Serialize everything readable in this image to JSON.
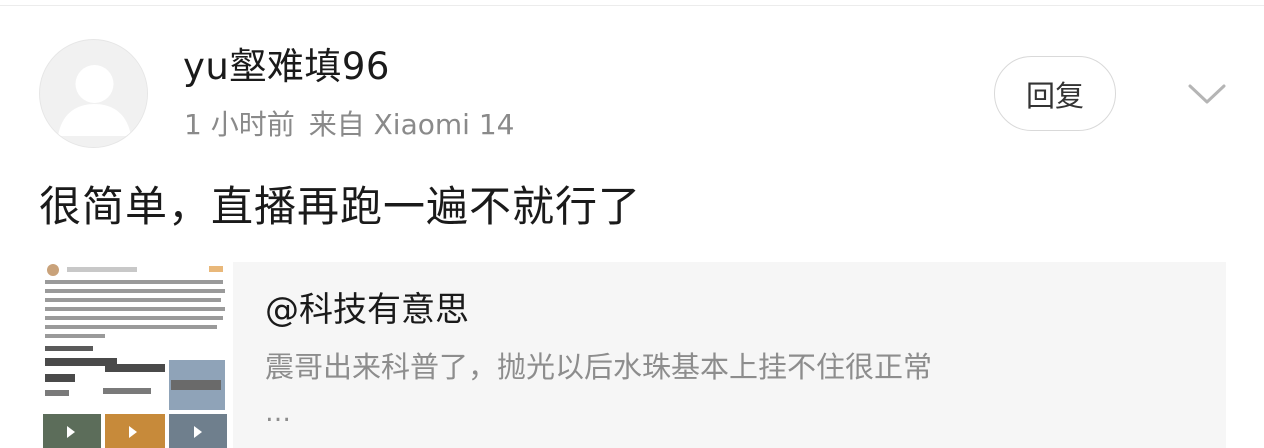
{
  "comment": {
    "username": "yu壑难填96",
    "time": "1 小时前",
    "source": "来自 Xiaomi 14",
    "reply_label": "回复",
    "text": "很简单，直播再跑一遍不就行了"
  },
  "quote": {
    "author": "@科技有意思",
    "body": "震哥出来科普了，抛光以后水珠基本上挂不住很正常",
    "ellipsis": "…"
  },
  "icons": {
    "avatar": "default-avatar-icon",
    "more": "chevron-down-icon"
  },
  "colors": {
    "text_primary": "#1a1a1a",
    "text_secondary": "#8a8a8a",
    "card_bg": "#f6f6f6",
    "border": "#d9d9d9"
  }
}
